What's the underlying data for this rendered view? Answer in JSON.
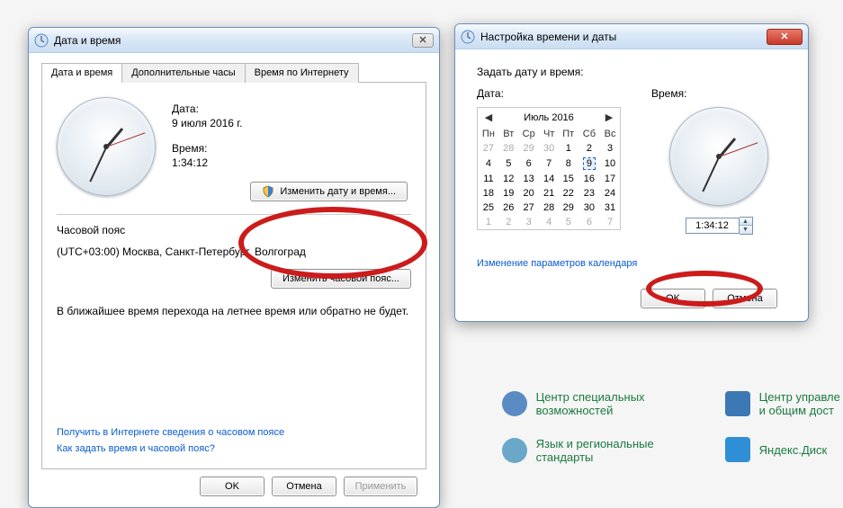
{
  "bg_links": {
    "center_special": "Центр специальных\nвозможностей",
    "lang_regional": "Язык и региональные\nстандарты",
    "center_mgmt": "Центр управле\nи общим дост",
    "yadisk": "Яндекс.Диск"
  },
  "main_window": {
    "title": "Дата и время",
    "tabs": {
      "t1": "Дата и время",
      "t2": "Дополнительные часы",
      "t3": "Время по Интернету"
    },
    "date_label": "Дата:",
    "date_value": "9 июля 2016 г.",
    "time_label": "Время:",
    "time_value": "1:34:12",
    "change_dt_btn": "Изменить дату и время...",
    "tz_heading": "Часовой пояс",
    "tz_value": "(UTC+03:00) Москва, Санкт-Петербург, Волгоград",
    "change_tz_btn": "Изменить часовой пояс...",
    "dst_note": "В ближайшее время перехода на летнее время или обратно не будет.",
    "link1": "Получить в Интернете сведения о часовом поясе",
    "link2": "Как задать время и часовой пояс?",
    "ok": "OK",
    "cancel": "Отмена",
    "apply": "Применить"
  },
  "set_window": {
    "title": "Настройка времени и даты",
    "heading": "Задать дату и время:",
    "date_label": "Дата:",
    "time_label": "Время:",
    "month_title": "Июль 2016",
    "dow": [
      "Пн",
      "Вт",
      "Ср",
      "Чт",
      "Пт",
      "Сб",
      "Вс"
    ],
    "weeks": [
      [
        {
          "n": 27,
          "dim": true
        },
        {
          "n": 28,
          "dim": true
        },
        {
          "n": 29,
          "dim": true
        },
        {
          "n": 30,
          "dim": true
        },
        {
          "n": 1
        },
        {
          "n": 2
        },
        {
          "n": 3
        }
      ],
      [
        {
          "n": 4
        },
        {
          "n": 5
        },
        {
          "n": 6
        },
        {
          "n": 7
        },
        {
          "n": 8
        },
        {
          "n": 9,
          "today": true
        },
        {
          "n": 10
        }
      ],
      [
        {
          "n": 11
        },
        {
          "n": 12
        },
        {
          "n": 13
        },
        {
          "n": 14
        },
        {
          "n": 15
        },
        {
          "n": 16
        },
        {
          "n": 17
        }
      ],
      [
        {
          "n": 18
        },
        {
          "n": 19
        },
        {
          "n": 20
        },
        {
          "n": 21
        },
        {
          "n": 22
        },
        {
          "n": 23
        },
        {
          "n": 24
        }
      ],
      [
        {
          "n": 25
        },
        {
          "n": 26
        },
        {
          "n": 27
        },
        {
          "n": 28
        },
        {
          "n": 29
        },
        {
          "n": 30
        },
        {
          "n": 31
        }
      ],
      [
        {
          "n": 1,
          "dim": true
        },
        {
          "n": 2,
          "dim": true
        },
        {
          "n": 3,
          "dim": true
        },
        {
          "n": 4,
          "dim": true
        },
        {
          "n": 5,
          "dim": true
        },
        {
          "n": 6,
          "dim": true
        },
        {
          "n": 7,
          "dim": true
        }
      ]
    ],
    "time_value": "1:34:12",
    "cal_link": "Изменение параметров календаря",
    "ok": "OK",
    "cancel": "Отмена"
  }
}
